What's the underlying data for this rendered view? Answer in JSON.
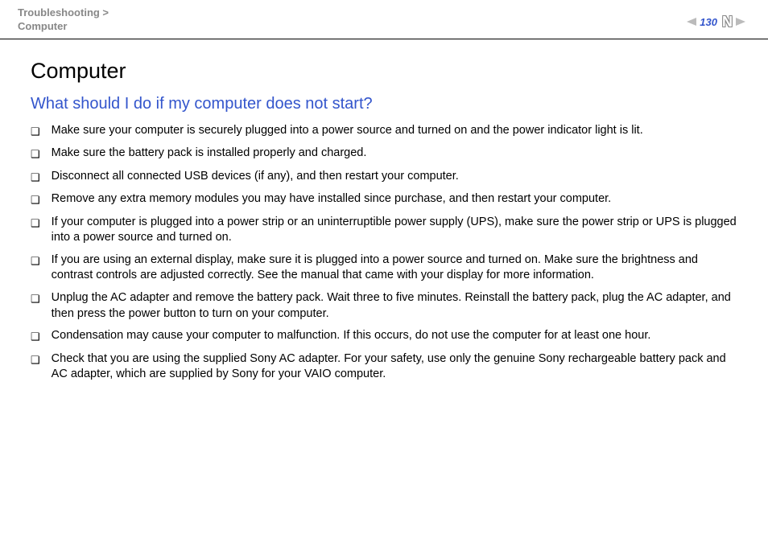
{
  "header": {
    "breadcrumb_line1": "Troubleshooting >",
    "breadcrumb_line2": "Computer",
    "page_number": "130"
  },
  "main": {
    "title": "Computer",
    "heading": "What should I do if my computer does not start?",
    "bullets": [
      "Make sure your computer is securely plugged into a power source and turned on and the power indicator light is lit.",
      "Make sure the battery pack is installed properly and charged.",
      "Disconnect all connected USB devices (if any), and then restart your computer.",
      "Remove any extra memory modules you may have installed since purchase, and then restart your computer.",
      "If your computer is plugged into a power strip or an uninterruptible power supply (UPS), make sure the power strip or UPS is plugged into a power source and turned on.",
      "If you are using an external display, make sure it is plugged into a power source and turned on. Make sure the brightness and contrast controls are adjusted correctly. See the manual that came with your display for more information.",
      "Unplug the AC adapter and remove the battery pack. Wait three to five minutes. Reinstall the battery pack, plug the AC adapter, and then press the power button to turn on your computer.",
      "Condensation may cause your computer to malfunction. If this occurs, do not use the computer for at least one hour.",
      "Check that you are using the supplied Sony AC adapter. For your safety, use only the genuine Sony rechargeable battery pack and AC adapter, which are supplied by Sony for your VAIO computer."
    ]
  }
}
